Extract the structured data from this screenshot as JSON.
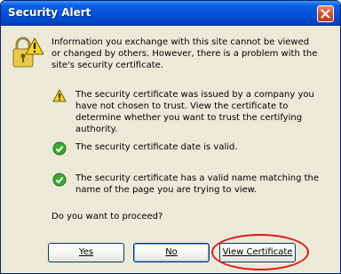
{
  "window": {
    "title": "Security Alert",
    "close_icon": "close-icon"
  },
  "message": {
    "intro": "Information you exchange with this site cannot be viewed or changed by others. However, there is a problem with the site's security certificate.",
    "items": [
      {
        "icon": "warning-icon",
        "text": "The security certificate was issued by a company you have not chosen to trust. View the certificate to determine whether you want to trust the certifying authority."
      },
      {
        "icon": "check-icon",
        "text": "The security certificate date is valid."
      },
      {
        "icon": "check-icon",
        "text": "The security certificate has a valid name matching the name of the page you are trying to view."
      }
    ],
    "question": "Do you want to proceed?"
  },
  "buttons": {
    "yes": "Yes",
    "no": "No",
    "view_certificate": "View Certificate"
  },
  "colors": {
    "titlebar": "#0453d6",
    "dialog_bg": "#ece9d8",
    "highlight": "#e01818"
  }
}
